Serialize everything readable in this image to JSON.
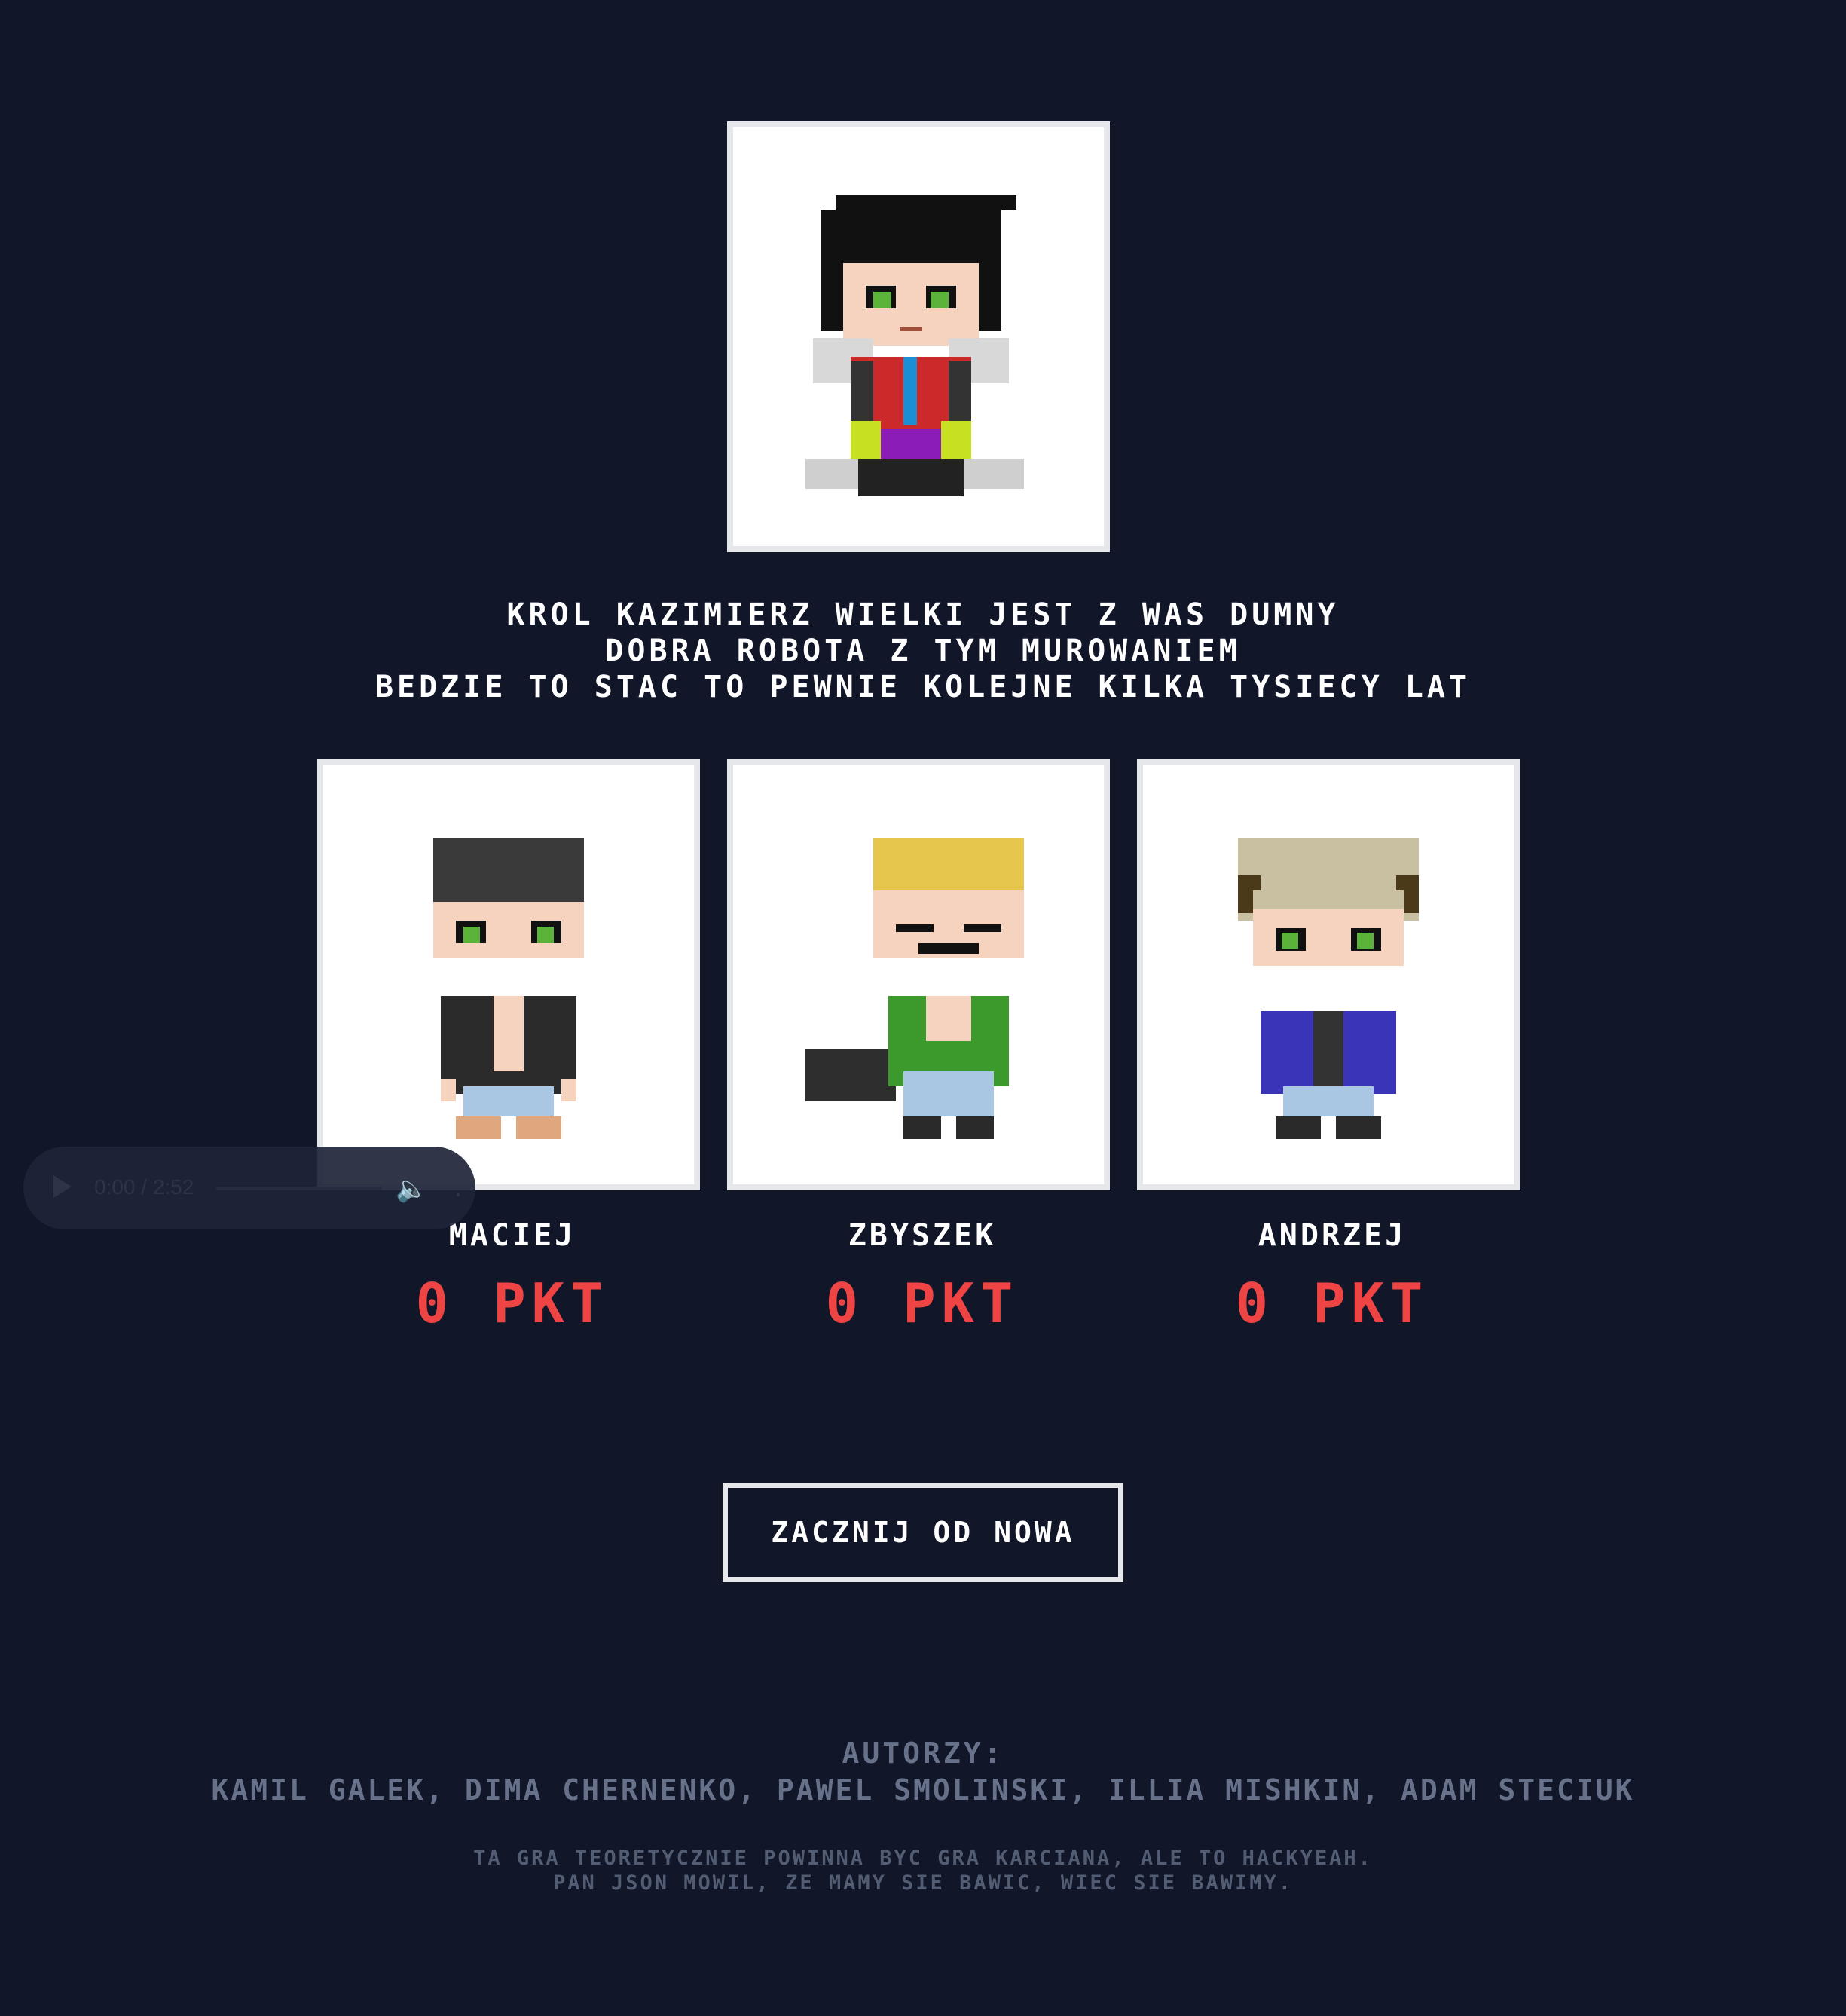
{
  "king": {
    "name": "Krol Kazimierz Wielki"
  },
  "message": {
    "line1": "Krol Kazimierz Wielki jest z was dumny",
    "line2": "Dobra robota z tym murowaniem",
    "line3": "Bedzie to stac to pewnie kolejne kilka tysiecy lat"
  },
  "players": [
    {
      "name": "Maciej",
      "score": "0 PKT"
    },
    {
      "name": "Zbyszek",
      "score": "0 PKT"
    },
    {
      "name": "Andrzej",
      "score": "0 PKT"
    }
  ],
  "audio": {
    "time": "0:00 / 2:52",
    "play_icon": "play-icon",
    "volume_icon": "volume-icon",
    "menu_icon": "more-vertical-icon"
  },
  "restart_label": "Zacznij od nowa",
  "credits": {
    "label": "Autorzy:",
    "names": "Kamil Galek, Dima Chernenko, Pawel Smolinski, Illia Mishkin, Adam Steciuk"
  },
  "footnote": {
    "line1": "Ta gra teoretycznie powinna byc gra karciana, ale to hackyeah.",
    "line2": "Pan Json mowil, ze mamy sie bawic, wiec sie bawimy."
  },
  "colors": {
    "background": "#111629",
    "card_border": "#e5e7eb",
    "score": "#ef4444",
    "credits_text": "#677189"
  }
}
